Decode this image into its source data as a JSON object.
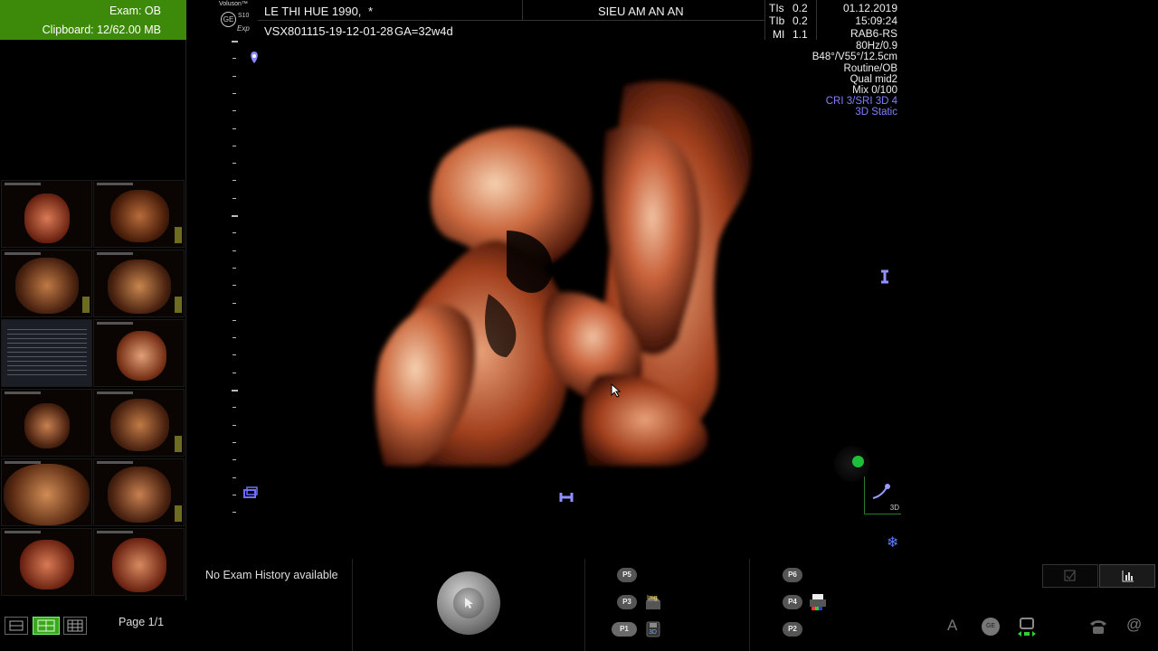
{
  "left_panel": {
    "exam_label": "Exam: OB",
    "clipboard_label": "Clipboard: 12/62.00 MB",
    "page_label": "Page 1/1"
  },
  "header": {
    "brand": "Voluson™",
    "model": "S10",
    "model_suffix": "Exp",
    "ge_logo": "GE",
    "patient_name": "LE THI HUE 1990,",
    "patient_marker": "*",
    "patient_id": "VSX801115-19-12-01-28",
    "gestational_age": "GA=32w4d",
    "clinic": "SIEU AM AN AN",
    "tis_label": "TIs",
    "tis_value": "0.2",
    "tib_label": "TIb",
    "tib_value": "0.2",
    "mi_label": "MI",
    "mi_value": "1.1",
    "date": "01.12.2019",
    "time": "15:09:24",
    "probe": "RAB6-RS"
  },
  "image_params": {
    "freq": "80Hz/0.9",
    "angles": "B48°/V55°/12.5cm",
    "preset": "Routine/OB",
    "quality": "Qual mid2",
    "mix": "Mix 0/100",
    "cri": "CRI 3/SRI 3D 4",
    "mode": "3D Static",
    "mode_badge": "3D"
  },
  "bottom": {
    "exam_history": "No Exam History available",
    "p_buttons": [
      "P5",
      "P3",
      "P1",
      "P6",
      "P4",
      "P2"
    ],
    "img_label": "Img",
    "badge_3d": "3D",
    "status_text_icon": "A",
    "ge_small": "GE"
  },
  "colors": {
    "exam_bg": "#3d8a0a",
    "params_accent": "#8080ff",
    "tissue": "#c8613a"
  },
  "icons": {
    "layout_single": "layout-single-icon",
    "layout_grid": "layout-grid-icon",
    "layout_grid_small": "layout-grid-small-icon",
    "trackball": "trackball-icon",
    "img_store": "image-store-icon",
    "save_3d": "save-3d-icon",
    "printer": "printer-icon",
    "checkbox": "checkbox-icon",
    "chart": "chart-icon",
    "probe": "probe-icon",
    "network": "network-icon",
    "phone": "phone-icon",
    "at": "at-icon",
    "gear": "gear-icon"
  }
}
